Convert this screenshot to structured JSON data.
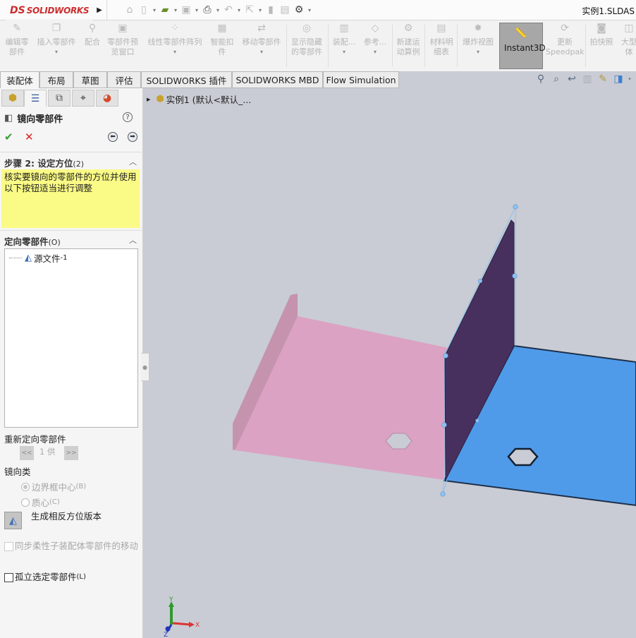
{
  "app": {
    "logo_prefix": "DS",
    "logo_text": "SOLIDWORKS",
    "document_title": "实例1.SLDAS"
  },
  "quick_access": [
    {
      "icon": "home-icon",
      "glyph": "⌂"
    },
    {
      "icon": "new-document-icon",
      "glyph": "▯"
    },
    {
      "icon": "open-folder-icon",
      "glyph": "📂"
    },
    {
      "icon": "save-icon",
      "glyph": "▣"
    },
    {
      "icon": "print-icon",
      "glyph": "⎙"
    },
    {
      "icon": "undo-icon",
      "glyph": "↶"
    },
    {
      "icon": "select-icon",
      "glyph": "⇱"
    },
    {
      "icon": "rebuild-icon",
      "glyph": "▮"
    },
    {
      "icon": "file-properties-icon",
      "glyph": "▤"
    },
    {
      "icon": "options-icon",
      "glyph": "⚙"
    }
  ],
  "ribbon": {
    "buttons": [
      {
        "label": "编辑零\n部件",
        "icon": "edit-component-icon"
      },
      {
        "label": "插入零部件",
        "icon": "insert-components-icon",
        "dropdown": true
      },
      {
        "label": "配合",
        "icon": "mate-icon"
      },
      {
        "label": "零部件预\n览窗口",
        "icon": "component-preview-icon"
      },
      {
        "label": "线性零部件阵列",
        "icon": "linear-pattern-icon",
        "dropdown": true
      },
      {
        "label": "智能扣\n件",
        "icon": "smart-fasteners-icon"
      },
      {
        "label": "移动零部件",
        "icon": "move-component-icon",
        "dropdown": true
      },
      {
        "label": "显示隐藏\n的零部件",
        "icon": "show-hidden-icon"
      },
      {
        "label": "装配...",
        "icon": "assembly-features-icon",
        "dropdown": true
      },
      {
        "label": "参考...",
        "icon": "reference-geometry-icon",
        "dropdown": true
      },
      {
        "label": "新建运\n动算例",
        "icon": "new-motion-study-icon"
      },
      {
        "label": "材料明\n细表",
        "icon": "bill-of-materials-icon"
      },
      {
        "label": "爆炸视图",
        "icon": "exploded-view-icon",
        "dropdown": true
      },
      {
        "label": "Instant3D",
        "icon": "instant3d-icon",
        "active": true
      },
      {
        "label": "更新\nSpeedpak",
        "icon": "update-speedpak-icon"
      },
      {
        "label": "拍快照",
        "icon": "snapshot-icon"
      },
      {
        "label": "大型\n体",
        "icon": "large-assembly-icon"
      }
    ]
  },
  "tabs": [
    {
      "label": "装配体",
      "active": true
    },
    {
      "label": "布局"
    },
    {
      "label": "草图"
    },
    {
      "label": "评估"
    },
    {
      "label": "SOLIDWORKS 插件"
    },
    {
      "label": "SOLIDWORKS MBD"
    },
    {
      "label": "Flow Simulation"
    }
  ],
  "panel_tabs": [
    {
      "icon": "featuremanager-icon"
    },
    {
      "icon": "propertymanager-icon",
      "active": true
    },
    {
      "icon": "configurationmanager-icon"
    },
    {
      "icon": "dimxpertmanager-icon"
    },
    {
      "icon": "display-manager-icon"
    }
  ],
  "property_manager": {
    "title": "镜向零部件",
    "help": "?",
    "ok": "✔",
    "cancel": "✕",
    "step": {
      "title": "步骤 2: 设定方位",
      "title_suffix": "(2)",
      "message": "核实要镜向的零部件的方位并使用以下按钮适当进行调整"
    },
    "oriented_components": {
      "title": "定向零部件",
      "title_suffix": "(O)",
      "items": [
        {
          "label": "源文件",
          "suffix": "-1"
        }
      ]
    },
    "reorient": {
      "label": "重新定向零部件",
      "prev": "<<",
      "counter": "1 供",
      "next": ">>"
    },
    "mirror_type": {
      "label": "镜向类",
      "options": [
        {
          "label": "边界框中心",
          "suffix": "(B)",
          "selected": true
        },
        {
          "label": "质心",
          "suffix": "(C)",
          "selected": false
        }
      ]
    },
    "create_opposite": "生成相反方位版本",
    "sync_flexible": {
      "label": "同步柔性子装配体零部件的移动",
      "checked": false,
      "enabled": false
    },
    "isolate": {
      "label": "孤立选定零部件",
      "suffix": "(L)",
      "checked": false
    }
  },
  "viewport": {
    "tree_root": "实例1  (默认<默认_...",
    "heads_up": [
      {
        "icon": "zoom-to-fit-icon",
        "glyph": "🔍"
      },
      {
        "icon": "zoom-to-area-icon",
        "glyph": "⌕"
      },
      {
        "icon": "previous-view-icon",
        "glyph": "↩"
      },
      {
        "icon": "section-view-icon",
        "glyph": "▥"
      },
      {
        "icon": "view-orientation-icon",
        "glyph": "✎"
      },
      {
        "icon": "display-style-icon",
        "glyph": "◨"
      }
    ],
    "triad": {
      "x": "X",
      "y": "Y",
      "z": "Z"
    },
    "colors": {
      "background": "#c9ccd4",
      "source_part": "#dba2c4",
      "source_flange": "#c593ad",
      "mirrored_wall": "#47305e",
      "mirrored_base": "#4f9bea",
      "handles": "#8ec1f1"
    }
  }
}
